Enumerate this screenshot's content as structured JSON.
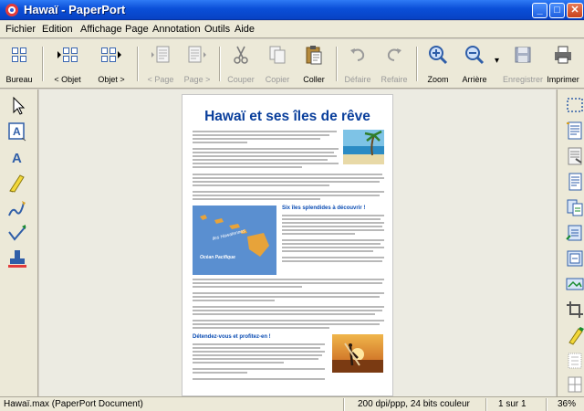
{
  "window": {
    "title": "Hawaï - PaperPort"
  },
  "menu": [
    "Fichier",
    "Edition",
    "Affichage",
    "Page",
    "Annotation",
    "Outils",
    "Aide"
  ],
  "toolbar": [
    {
      "label": "Bureau",
      "icon": "desktop-icon",
      "enabled": true
    },
    {
      "label": "< Objet",
      "icon": "previous-object-icon",
      "enabled": true
    },
    {
      "label": "Objet >",
      "icon": "next-object-icon",
      "enabled": true
    },
    {
      "label": "< Page",
      "icon": "previous-page-icon",
      "enabled": false
    },
    {
      "label": "Page >",
      "icon": "next-page-icon",
      "enabled": false
    },
    {
      "label": "Couper",
      "icon": "cut-icon",
      "enabled": false
    },
    {
      "label": "Copier",
      "icon": "copy-icon",
      "enabled": false
    },
    {
      "label": "Coller",
      "icon": "paste-icon",
      "enabled": true
    },
    {
      "label": "Défaire",
      "icon": "undo-icon",
      "enabled": false
    },
    {
      "label": "Refaire",
      "icon": "redo-icon",
      "enabled": false
    },
    {
      "label": "Zoom",
      "icon": "zoom-in-icon",
      "enabled": true
    },
    {
      "label": "Arrière",
      "icon": "zoom-out-icon",
      "enabled": true
    },
    {
      "label": "Enregistrer",
      "icon": "save-icon",
      "enabled": false
    },
    {
      "label": "Imprimer",
      "icon": "print-icon",
      "enabled": true
    }
  ],
  "document": {
    "title": "Hawaï et ses îles de rêve",
    "section1": "Six îles splendides à découvrir !",
    "section2": "Détendez-vous et profitez-en !",
    "map_label_islands": "Iles Hawaïennes",
    "map_label_ocean": "Océan Pacifique"
  },
  "status": {
    "file": "Hawaï.max (PaperPort Document)",
    "resolution": "200 dpi/ppp, 24 bits couleur",
    "page": "1 sur 1",
    "zoom": "36%"
  },
  "colors": {
    "title_bar": "#0a4fd8",
    "doc_title": "#0a3f9c",
    "workspace": "#ecebe2",
    "chrome": "#ece9d8"
  }
}
